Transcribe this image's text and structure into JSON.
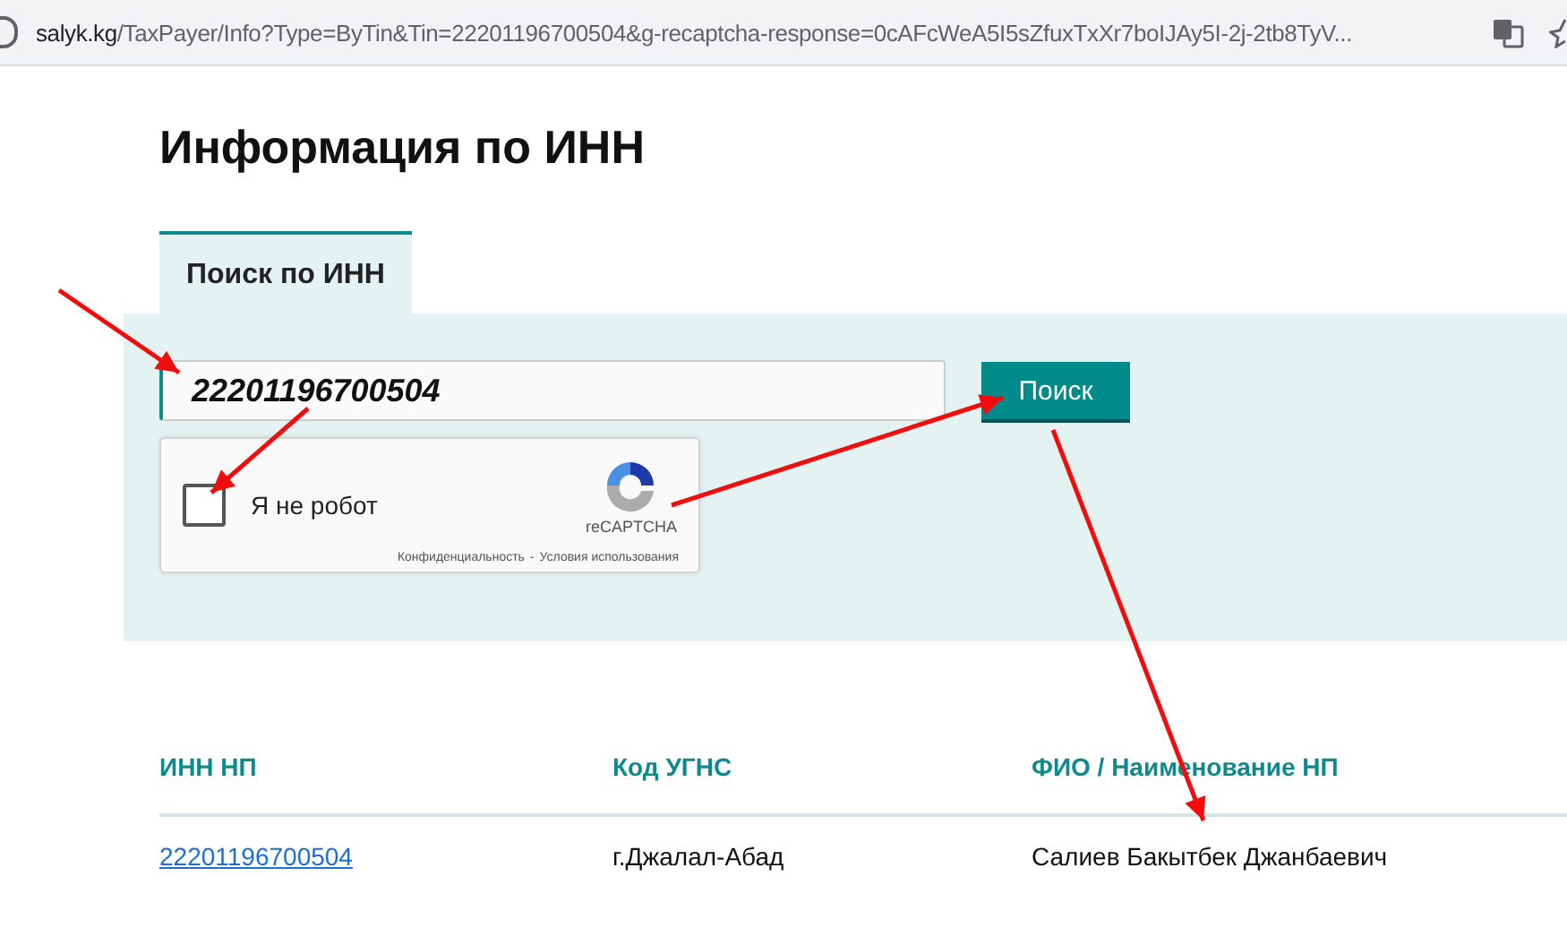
{
  "address_bar": {
    "host": "salyk.kg",
    "path": "/TaxPayer/Info?Type=ByTin&Tin=22201196700504&g-recaptcha-response=0cAFcWeA5I5sZfuxTxXr7boIJAy5I-2j-2tb8TyV..."
  },
  "title": "Информация по ИНН",
  "tabs": [
    {
      "label": "Поиск по ИНН",
      "selected": true
    }
  ],
  "search": {
    "value": "22201196700504",
    "button": "Поиск"
  },
  "captcha": {
    "checked": false,
    "label": "Я не робот",
    "brand": "reCAPTCHA",
    "privacy": "Конфиденциальность",
    "separator": "-",
    "terms": "Условия использования"
  },
  "table": {
    "columns": [
      "ИНН НП",
      "Код УГНС",
      "ФИО / Наименование НП"
    ],
    "rows": [
      [
        "22201196700504",
        "г.Джалал-Абад",
        "Салиев Бакытбек Джанбаевич"
      ]
    ]
  }
}
